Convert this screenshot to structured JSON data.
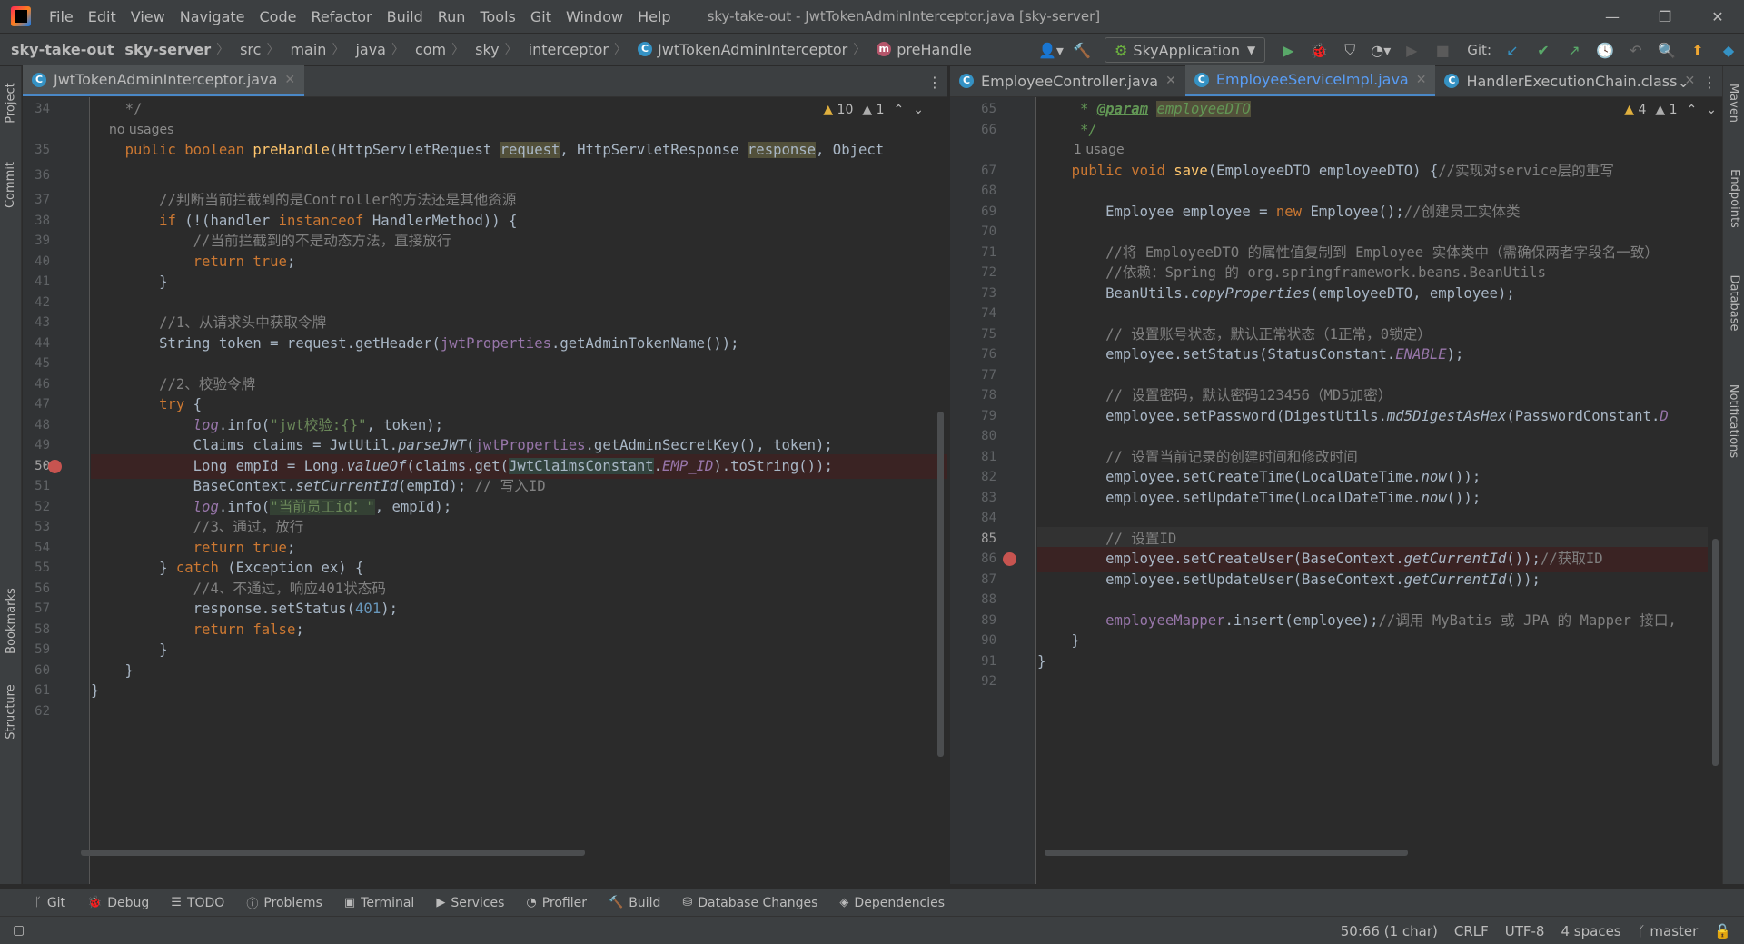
{
  "menubar": {
    "items": [
      "File",
      "Edit",
      "View",
      "Navigate",
      "Code",
      "Refactor",
      "Build",
      "Run",
      "Tools",
      "Git",
      "Window",
      "Help"
    ],
    "title": "sky-take-out - JwtTokenAdminInterceptor.java [sky-server]"
  },
  "navbar": {
    "crumbs": [
      "sky-take-out",
      "sky-server",
      "src",
      "main",
      "java",
      "com",
      "sky",
      "interceptor",
      "JwtTokenAdminInterceptor",
      "preHandle"
    ],
    "run_config": "SkyApplication",
    "git_label": "Git:"
  },
  "left_strip": [
    "Project",
    "Commit",
    "Bookmarks",
    "Structure"
  ],
  "right_strip": [
    "Maven",
    "Endpoints",
    "Database",
    "Notifications"
  ],
  "left_editor": {
    "tabs": [
      {
        "label": "JwtTokenAdminInterceptor.java",
        "active": true
      }
    ],
    "warnings": "10",
    "weak_warnings": "1",
    "usage_hint": "no usages"
  },
  "right_editor": {
    "tabs": [
      {
        "label": "EmployeeController.java",
        "active": false
      },
      {
        "label": "EmployeeServiceImpl.java",
        "active": true
      },
      {
        "label": "HandlerExecutionChain.class",
        "active": false
      }
    ],
    "warnings": "4",
    "weak_warnings": "1",
    "usage_hint": "1 usage"
  },
  "left_code": {
    "line_numbers": [
      "34",
      "35",
      "36",
      "37",
      "38",
      "39",
      "40",
      "41",
      "42",
      "43",
      "44",
      "45",
      "46",
      "47",
      "48",
      "49",
      "50",
      "51",
      "52",
      "53",
      "54",
      "55",
      "56",
      "57",
      "58",
      "59",
      "60",
      "61",
      "62"
    ],
    "breakpoint_line": "50",
    "current_line": "50"
  },
  "right_code": {
    "line_numbers": [
      "65",
      "66",
      "67",
      "68",
      "69",
      "70",
      "71",
      "72",
      "73",
      "74",
      "75",
      "76",
      "77",
      "78",
      "79",
      "80",
      "81",
      "82",
      "83",
      "84",
      "85",
      "86",
      "87",
      "88",
      "89",
      "90",
      "91",
      "92"
    ],
    "breakpoint_line": "86",
    "current_line": "85"
  },
  "bottom_tools": [
    "Git",
    "Debug",
    "TODO",
    "Problems",
    "Terminal",
    "Services",
    "Profiler",
    "Build",
    "Database Changes",
    "Dependencies"
  ],
  "status": {
    "position": "50:66 (1 char)",
    "line_sep": "CRLF",
    "encoding": "UTF-8",
    "indent": "4 spaces",
    "branch": "master"
  },
  "colors": {
    "keyword": "#cc7832",
    "string": "#6a8759",
    "comment": "#808080",
    "function": "#ffc66d",
    "field": "#9876aa",
    "number": "#6897bb",
    "breakpoint": "#c75450",
    "accent": "#4a88c7"
  }
}
